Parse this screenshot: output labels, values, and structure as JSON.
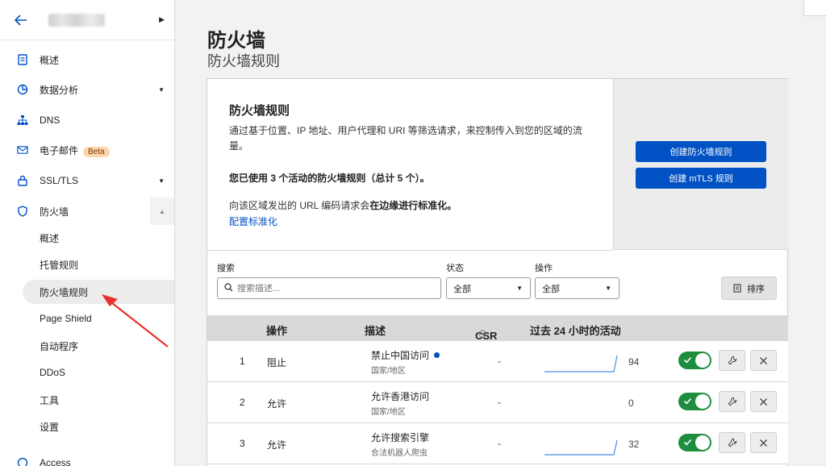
{
  "sidebar": {
    "items": [
      {
        "label": "概述",
        "icon": "document-icon"
      },
      {
        "label": "数据分析",
        "icon": "chart-pie-icon",
        "expandable": true
      },
      {
        "label": "DNS",
        "icon": "network-icon"
      },
      {
        "label": "电子邮件",
        "icon": "email-icon",
        "badge": "Beta"
      },
      {
        "label": "SSL/TLS",
        "icon": "lock-icon",
        "expandable": true
      },
      {
        "label": "防火墙",
        "icon": "shield-icon",
        "expanded": true
      }
    ],
    "firewall_sub": [
      "概述",
      "托管规则",
      "防火墙规则",
      "Page Shield",
      "自动程序",
      "DDoS",
      "工具",
      "设置"
    ],
    "active_sub": "防火墙规则",
    "bottom_item": "Access"
  },
  "header": {
    "title": "防火墙",
    "subtitle": "防火墙规则"
  },
  "intro": {
    "title": "防火墙规则",
    "description": "通过基于位置、IP 地址、用户代理和 URI 等筛选请求，来控制传入到您的区域的流量。",
    "active_count": "您已使用 3 个活动的防火墙规则（总计 5 个）。",
    "normalize_text": "向该区域发出的 URL 编码请求会",
    "normalize_bold": "在边缘进行标准化。",
    "link": "配置标准化"
  },
  "actions": {
    "create_rule": "创建防火墙规则",
    "create_mtls": "创建 mTLS 规则"
  },
  "filters": {
    "search_label": "搜索",
    "search_placeholder": "搜索描述...",
    "status_label": "状态",
    "status_value": "全部",
    "action_label": "操作",
    "action_value": "全部",
    "sort_label": "排序"
  },
  "table": {
    "headers": {
      "action": "操作",
      "description": "描述",
      "csr": "CSR",
      "activity": "过去 24 小时的活动"
    },
    "rows": [
      {
        "num": "1",
        "action": "阻止",
        "title": "禁止中国访问",
        "subtitle": "国家/地区",
        "new": true,
        "csr": "-",
        "count": "94",
        "enabled": true
      },
      {
        "num": "2",
        "action": "允许",
        "title": "允许香港访问",
        "subtitle": "国家/地区",
        "new": false,
        "csr": "-",
        "count": "0",
        "enabled": true
      },
      {
        "num": "3",
        "action": "允许",
        "title": "允许搜索引擎",
        "subtitle": "合法机器人爬虫",
        "new": false,
        "csr": "-",
        "count": "32",
        "enabled": true
      }
    ]
  },
  "colors": {
    "accent": "#0051c3",
    "toggle_on": "#1e8e3e",
    "annotation_arrow": "#e8322c"
  }
}
